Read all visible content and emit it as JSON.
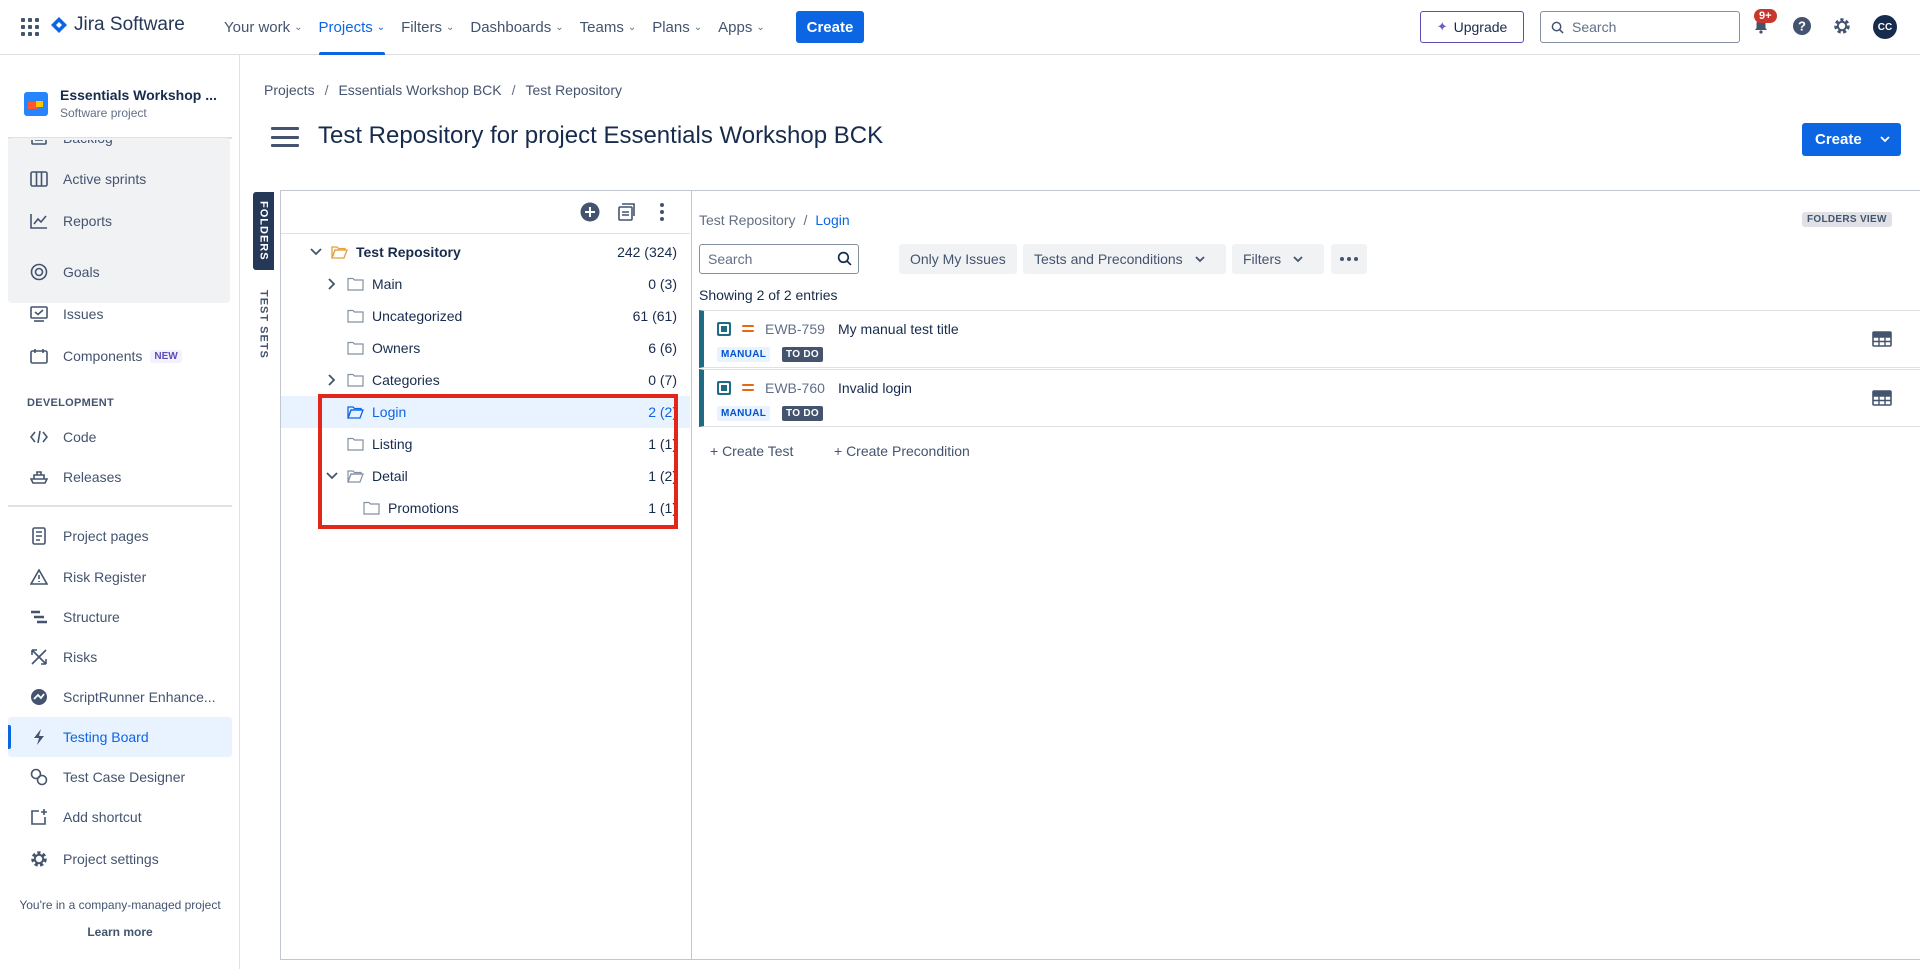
{
  "topnav": {
    "logo_text": "Jira Software",
    "menu": [
      {
        "label": "Your work"
      },
      {
        "label": "Projects"
      },
      {
        "label": "Filters"
      },
      {
        "label": "Dashboards"
      },
      {
        "label": "Teams"
      },
      {
        "label": "Plans"
      },
      {
        "label": "Apps"
      }
    ],
    "create_label": "Create",
    "upgrade_label": "Upgrade",
    "search_placeholder": "Search",
    "notif_badge": "9+",
    "avatar_initials": "CC",
    "accent": "#0c66e4"
  },
  "sidebar": {
    "project_name": "Essentials Workshop ...",
    "project_type": "Software project",
    "group_items": [
      {
        "label": "Backlog",
        "icon": "backlog-icon"
      },
      {
        "label": "Active sprints",
        "icon": "board-icon"
      },
      {
        "label": "Reports",
        "icon": "chart-icon"
      }
    ],
    "items": [
      {
        "label": "Goals",
        "icon": "target-icon"
      },
      {
        "label": "Issues",
        "icon": "issues-icon"
      },
      {
        "label": "Components",
        "icon": "components-icon",
        "badge": "NEW"
      }
    ],
    "dev_heading": "DEVELOPMENT",
    "dev_items": [
      {
        "label": "Code",
        "icon": "code-icon"
      },
      {
        "label": "Releases",
        "icon": "ship-icon"
      }
    ],
    "app_items": [
      {
        "label": "Project pages",
        "icon": "page-icon"
      },
      {
        "label": "Risk Register",
        "icon": "warning-icon"
      },
      {
        "label": "Structure",
        "icon": "structure-icon"
      },
      {
        "label": "Risks",
        "icon": "risks-icon"
      },
      {
        "label": "ScriptRunner Enhance...",
        "icon": "scriptrunner-icon"
      },
      {
        "label": "Testing Board",
        "icon": "bolt-icon"
      },
      {
        "label": "Test Case Designer",
        "icon": "designer-icon"
      },
      {
        "label": "Add shortcut",
        "icon": "add-shortcut-icon"
      },
      {
        "label": "Project settings",
        "icon": "gear-icon"
      }
    ],
    "footer_text": "You're in a company-managed project",
    "learn_more": "Learn more"
  },
  "main": {
    "breadcrumbs": [
      "Projects",
      "Essentials Workshop BCK",
      "Test Repository"
    ],
    "title": "Test Repository for project Essentials Workshop BCK",
    "create_label": "Create",
    "vtabs": [
      "FOLDERS",
      "TEST SETS"
    ]
  },
  "tree": {
    "rows": [
      {
        "label": "Test Repository",
        "count": "242 (324)",
        "expanded": true
      },
      {
        "label": "Main",
        "count": "0 (3)",
        "collapsed": true
      },
      {
        "label": "Uncategorized",
        "count": "61 (61)"
      },
      {
        "label": "Owners",
        "count": "6 (6)"
      },
      {
        "label": "Categories",
        "count": "0 (7)",
        "collapsed": true
      },
      {
        "label": "Login",
        "count": "2 (2)",
        "selected": true
      },
      {
        "label": "Listing",
        "count": "1 (1)"
      },
      {
        "label": "Detail",
        "count": "1 (2)",
        "expanded": true
      },
      {
        "label": "Promotions",
        "count": "1 (1)"
      }
    ]
  },
  "list": {
    "breadcrumb": [
      "Test Repository",
      "Login"
    ],
    "view_label": "FOLDERS VIEW",
    "search_placeholder": "Search",
    "filters": [
      "Only My Issues",
      "Tests and Preconditions",
      "Filters"
    ],
    "showing": "Showing 2 of 2 entries",
    "items": [
      {
        "key": "EWB-759",
        "summary": "My manual test title",
        "type_tag": "MANUAL",
        "status": "TO DO"
      },
      {
        "key": "EWB-760",
        "summary": "Invalid login",
        "type_tag": "MANUAL",
        "status": "TO DO"
      }
    ],
    "create_test": "+ Create Test",
    "create_precondition": "+ Create Precondition"
  }
}
